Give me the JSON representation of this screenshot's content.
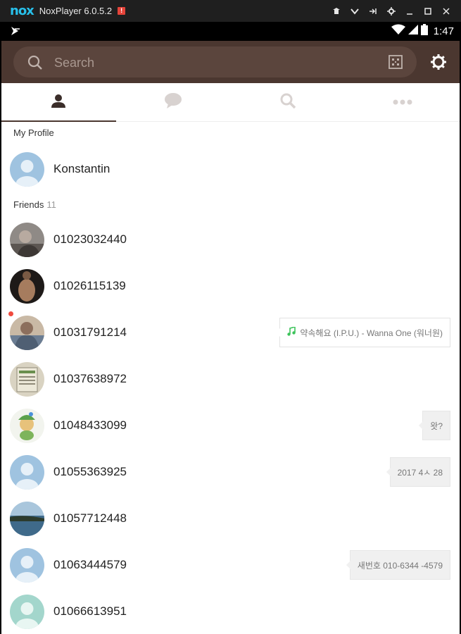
{
  "window": {
    "logo": "nox",
    "title": "NoxPlayer 6.0.5.2",
    "warning": "!",
    "controls": [
      "pin-icon",
      "chevron-down-icon",
      "sidebar-icon",
      "settings-icon",
      "minimize-icon",
      "maximize-icon",
      "close-icon"
    ]
  },
  "statusbar": {
    "time": "1:47",
    "icons": [
      "wifi-icon",
      "signal-icon",
      "battery-icon"
    ]
  },
  "search": {
    "placeholder": "Search",
    "value": ""
  },
  "tabs": [
    {
      "name": "friends",
      "icon": "person-icon",
      "active": true
    },
    {
      "name": "chats",
      "icon": "chat-icon",
      "active": false
    },
    {
      "name": "find",
      "icon": "search-icon",
      "active": false
    },
    {
      "name": "more",
      "icon": "more-icon",
      "active": false
    }
  ],
  "my_profile": {
    "header": "My Profile",
    "name": "Konstantin"
  },
  "friends": {
    "header": "Friends",
    "count": "11",
    "items": [
      {
        "name": "01023032440",
        "status": "",
        "avatar_color": "#7b7b7b"
      },
      {
        "name": "01026115139",
        "status": "",
        "avatar_color": "#2a2521"
      },
      {
        "name": "01031791214",
        "status": "약속해요 (I.P.U.) - Wanna One (워너원)",
        "music": true,
        "new": true,
        "avatar_color": "#8a7f77"
      },
      {
        "name": "01037638972",
        "status": "",
        "avatar_color": "#d6d0bf"
      },
      {
        "name": "01048433099",
        "status": "왓?",
        "avatar_color": "#e9efe3"
      },
      {
        "name": "01055363925",
        "status": "2017 4ㅅ 28",
        "avatar_color": "#9fc3e0"
      },
      {
        "name": "01057712448",
        "status": "",
        "avatar_color": "#6b8aa4"
      },
      {
        "name": "01063444579",
        "status": "새번호  010-6344 -4579",
        "avatar_color": "#9fc3e0"
      },
      {
        "name": "01066613951",
        "status": "",
        "avatar_color": "#a3d6cc"
      }
    ]
  },
  "colors": {
    "brand_header": "#4b3730",
    "search_pill": "#5b453d",
    "default_avatar": "#9fc3e0",
    "music_note": "#3cc35a",
    "new_dot": "#f04a3e"
  }
}
